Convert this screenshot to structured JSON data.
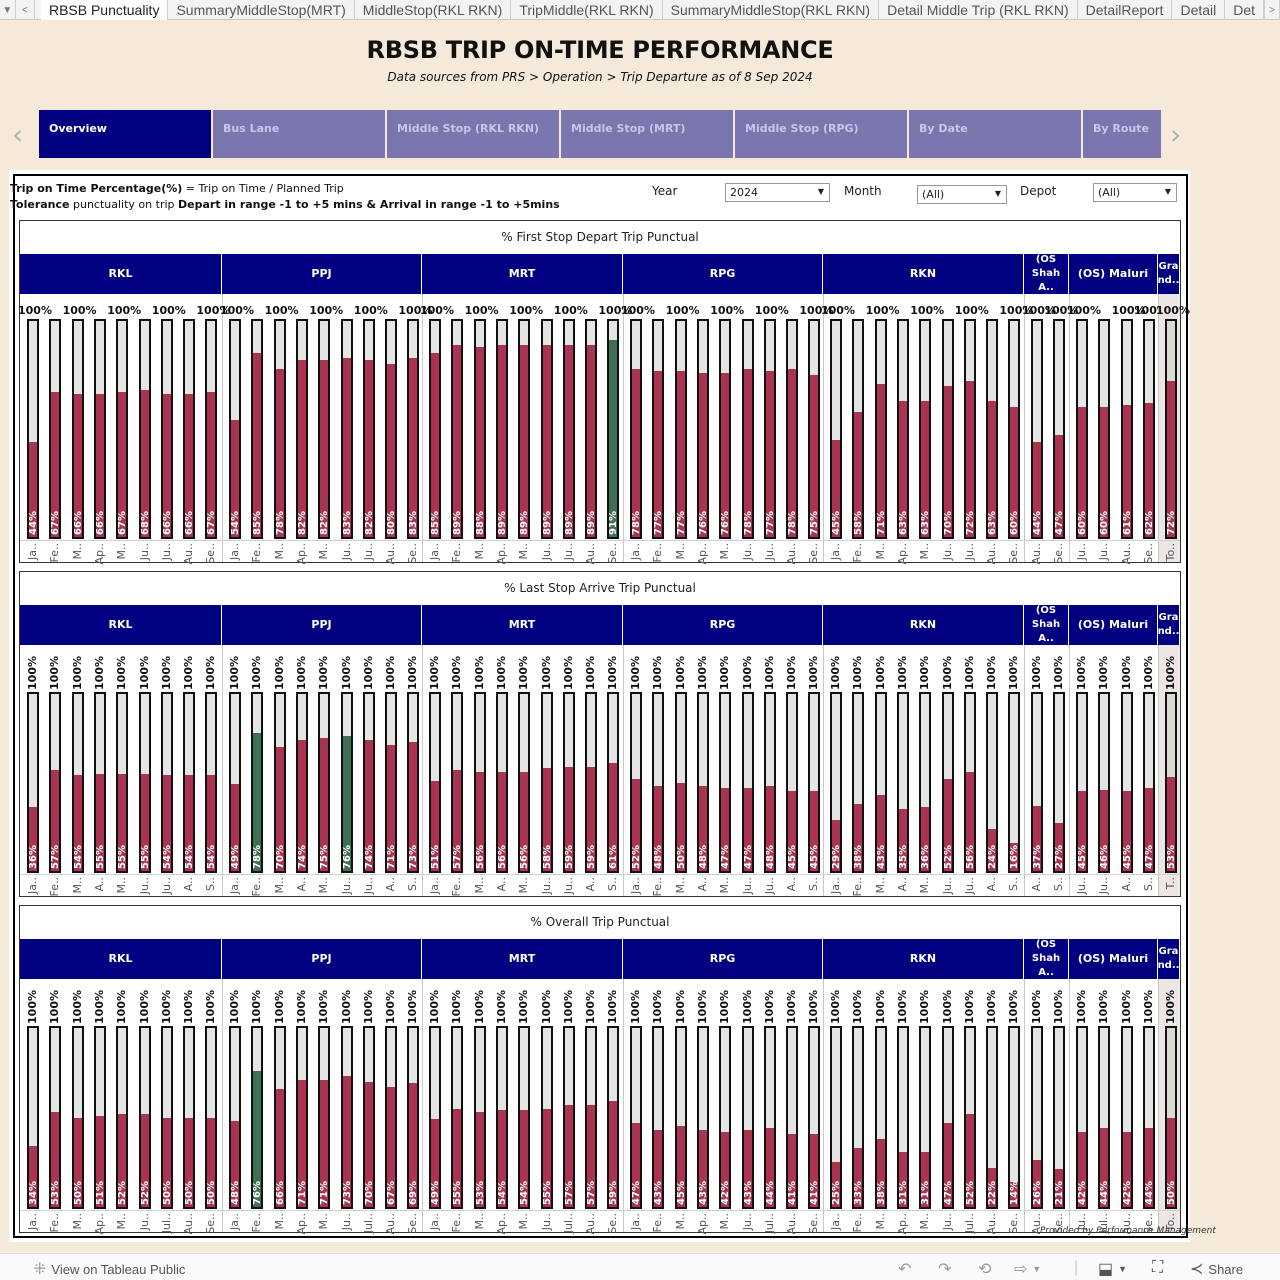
{
  "tabs": {
    "items": [
      "RBSB Punctuality",
      "SummaryMiddleStop(MRT)",
      "MiddleStop(RKL RKN)",
      "TripMiddle(RKL RKN)",
      "SummaryMiddleStop(RKL RKN)",
      "Detail Middle Trip (RKL RKN)",
      "DetailReport",
      "Detail",
      "Det"
    ],
    "active_index": 0
  },
  "header": {
    "title": "RBSB TRIP ON-TIME PERFORMANCE",
    "subtitle": "Data sources from PRS > Operation > Trip Departure as of 8 Sep 2024"
  },
  "nav_buttons": [
    "Overview",
    "Bus Lane",
    "Middle Stop (RKL RKN)",
    "Middle Stop (MRT)",
    "Middle Stop (RPG)",
    "By Date",
    "By Route"
  ],
  "definitions": {
    "line1_bold": "Trip on Time Percentage(%)",
    "line1_rest": " = Trip on Time / Planned Trip",
    "line2_bold1": "Tolerance",
    "line2_mid": " punctuality on trip ",
    "line2_bold2": "Depart in range -1 to +5 mins & Arrival in range -1 to +5mins"
  },
  "filters": {
    "year_label": "Year",
    "year_value": "2024",
    "month_label": "Month",
    "month_value": "(All)",
    "depot_label": "Depot",
    "depot_value": "(All)"
  },
  "colors": {
    "header_navy": "#000080",
    "bar_red": "#a8344f",
    "bar_green": "#3e7153",
    "bar_bg": "#e4e4e4"
  },
  "chart_data": [
    {
      "type": "bar",
      "title": "% First Stop Depart Trip Punctual",
      "groups": [
        {
          "name": "RKL",
          "months": [
            "Ja..",
            "Fe..",
            "M..",
            "Ap..",
            "M..",
            "Ju..",
            "Ju..",
            "Au..",
            "Se.."
          ],
          "values": [
            44,
            67,
            66,
            66,
            67,
            68,
            66,
            66,
            67
          ]
        },
        {
          "name": "PPJ",
          "months": [
            "Ja..",
            "Fe..",
            "M..",
            "Ap..",
            "M..",
            "Ju..",
            "Ju..",
            "Au..",
            "Se.."
          ],
          "values": [
            54,
            85,
            78,
            82,
            82,
            83,
            82,
            80,
            83
          ]
        },
        {
          "name": "MRT",
          "months": [
            "Ja..",
            "Fe..",
            "M..",
            "Ap..",
            "M..",
            "Ju..",
            "Ju..",
            "Au..",
            "Se.."
          ],
          "values": [
            85,
            89,
            88,
            89,
            89,
            89,
            89,
            89,
            91
          ],
          "highlight": [
            8
          ]
        },
        {
          "name": "RPG",
          "months": [
            "Ja..",
            "Fe..",
            "M..",
            "Ap..",
            "M..",
            "Ju..",
            "Ju..",
            "Au..",
            "Se.."
          ],
          "values": [
            78,
            77,
            77,
            76,
            76,
            78,
            77,
            78,
            75
          ]
        },
        {
          "name": "RKN",
          "months": [
            "Ja..",
            "Fe..",
            "M..",
            "Ap..",
            "M..",
            "Ju..",
            "Ju..",
            "Au..",
            "Se.."
          ],
          "values": [
            45,
            58,
            71,
            63,
            63,
            70,
            72,
            63,
            60
          ]
        },
        {
          "name": "(OS Shah A..",
          "months": [
            "Au..",
            "Se.."
          ],
          "values": [
            44,
            47
          ]
        },
        {
          "name": "(OS) Maluri",
          "months": [
            "Ju..",
            "Ju..",
            "Au..",
            "Se.."
          ],
          "values": [
            60,
            60,
            61,
            62
          ]
        },
        {
          "name": "Gra nd..",
          "months": [
            "To.."
          ],
          "values": [
            72
          ],
          "grand": true
        }
      ],
      "top_label": "100%",
      "ylim": [
        0,
        100
      ]
    },
    {
      "type": "bar",
      "title": "% Last Stop Arrive Trip Punctual",
      "groups": [
        {
          "name": "RKL",
          "months": [
            "Ja..",
            "Fe..",
            "M..",
            "A..",
            "M..",
            "Ju..",
            "Ju..",
            "A..",
            "S.."
          ],
          "values": [
            36,
            57,
            54,
            55,
            55,
            55,
            54,
            54,
            54
          ]
        },
        {
          "name": "PPJ",
          "months": [
            "Ja..",
            "Fe..",
            "M..",
            "A..",
            "M..",
            "Ju..",
            "Ju..",
            "A..",
            "S.."
          ],
          "values": [
            49,
            78,
            70,
            74,
            75,
            76,
            74,
            71,
            73
          ],
          "highlight": [
            1,
            5
          ]
        },
        {
          "name": "MRT",
          "months": [
            "Ja..",
            "Fe..",
            "M..",
            "A..",
            "M..",
            "Ju..",
            "Ju..",
            "A..",
            "S.."
          ],
          "values": [
            51,
            57,
            56,
            56,
            56,
            58,
            59,
            59,
            61
          ]
        },
        {
          "name": "RPG",
          "months": [
            "Ja..",
            "Fe..",
            "M..",
            "A..",
            "M..",
            "Ju..",
            "Ju..",
            "A..",
            "S.."
          ],
          "values": [
            52,
            48,
            50,
            48,
            47,
            47,
            48,
            45,
            45
          ]
        },
        {
          "name": "RKN",
          "months": [
            "Ja..",
            "Fe..",
            "M..",
            "A..",
            "M..",
            "Ju..",
            "Ju..",
            "A..",
            "S.."
          ],
          "values": [
            29,
            38,
            43,
            35,
            36,
            52,
            56,
            24,
            16
          ]
        },
        {
          "name": "(OS Shah A..",
          "months": [
            "A..",
            "S.."
          ],
          "values": [
            37,
            27
          ]
        },
        {
          "name": "(OS) Maluri",
          "months": [
            "Ju..",
            "Ju..",
            "A..",
            "S.."
          ],
          "values": [
            45,
            46,
            45,
            47
          ]
        },
        {
          "name": "Gra nd..",
          "months": [
            "T.."
          ],
          "values": [
            53
          ],
          "grand": true
        }
      ],
      "top_label": "100%",
      "ylim": [
        0,
        100
      ]
    },
    {
      "type": "bar",
      "title": "% Overall Trip Punctual",
      "groups": [
        {
          "name": "RKL",
          "months": [
            "Ja..",
            "Fe..",
            "M..",
            "Ap..",
            "M..",
            "Ju..",
            "Jul..",
            "Au..",
            "Se.."
          ],
          "values": [
            34,
            53,
            50,
            51,
            52,
            52,
            50,
            50,
            50
          ]
        },
        {
          "name": "PPJ",
          "months": [
            "Ja..",
            "Fe..",
            "M..",
            "Ap..",
            "M..",
            "Ju..",
            "Jul..",
            "Au..",
            "Se.."
          ],
          "values": [
            48,
            76,
            66,
            71,
            71,
            73,
            70,
            67,
            69
          ],
          "highlight": [
            1
          ]
        },
        {
          "name": "MRT",
          "months": [
            "Ja..",
            "Fe..",
            "M..",
            "Ap..",
            "M..",
            "Ju..",
            "Jul..",
            "Au..",
            "Se.."
          ],
          "values": [
            49,
            55,
            53,
            54,
            54,
            55,
            57,
            57,
            59
          ]
        },
        {
          "name": "RPG",
          "months": [
            "Ja..",
            "Fe..",
            "M..",
            "Ap..",
            "M..",
            "Ju..",
            "Jul..",
            "Au..",
            "Se.."
          ],
          "values": [
            47,
            43,
            45,
            43,
            42,
            43,
            44,
            41,
            41
          ]
        },
        {
          "name": "RKN",
          "months": [
            "Ja..",
            "Fe..",
            "M..",
            "Ap..",
            "M..",
            "Ju..",
            "Jul..",
            "Au..",
            "Se.."
          ],
          "values": [
            25,
            33,
            38,
            31,
            31,
            47,
            52,
            22,
            14
          ]
        },
        {
          "name": "(OS Shah A..",
          "months": [
            "Au..",
            "Se.."
          ],
          "values": [
            26,
            21
          ]
        },
        {
          "name": "(OS) Maluri",
          "months": [
            "Ju..",
            "Jul..",
            "Au..",
            "Se.."
          ],
          "values": [
            42,
            44,
            42,
            44
          ]
        },
        {
          "name": "Gra nd..",
          "months": [
            "To.."
          ],
          "values": [
            50
          ],
          "grand": true
        }
      ],
      "top_label": "100%",
      "ylim": [
        0,
        100
      ]
    }
  ],
  "credit": "Provided by Performance Management",
  "bottombar": {
    "view_on": "View on Tableau Public",
    "share": "Share"
  }
}
